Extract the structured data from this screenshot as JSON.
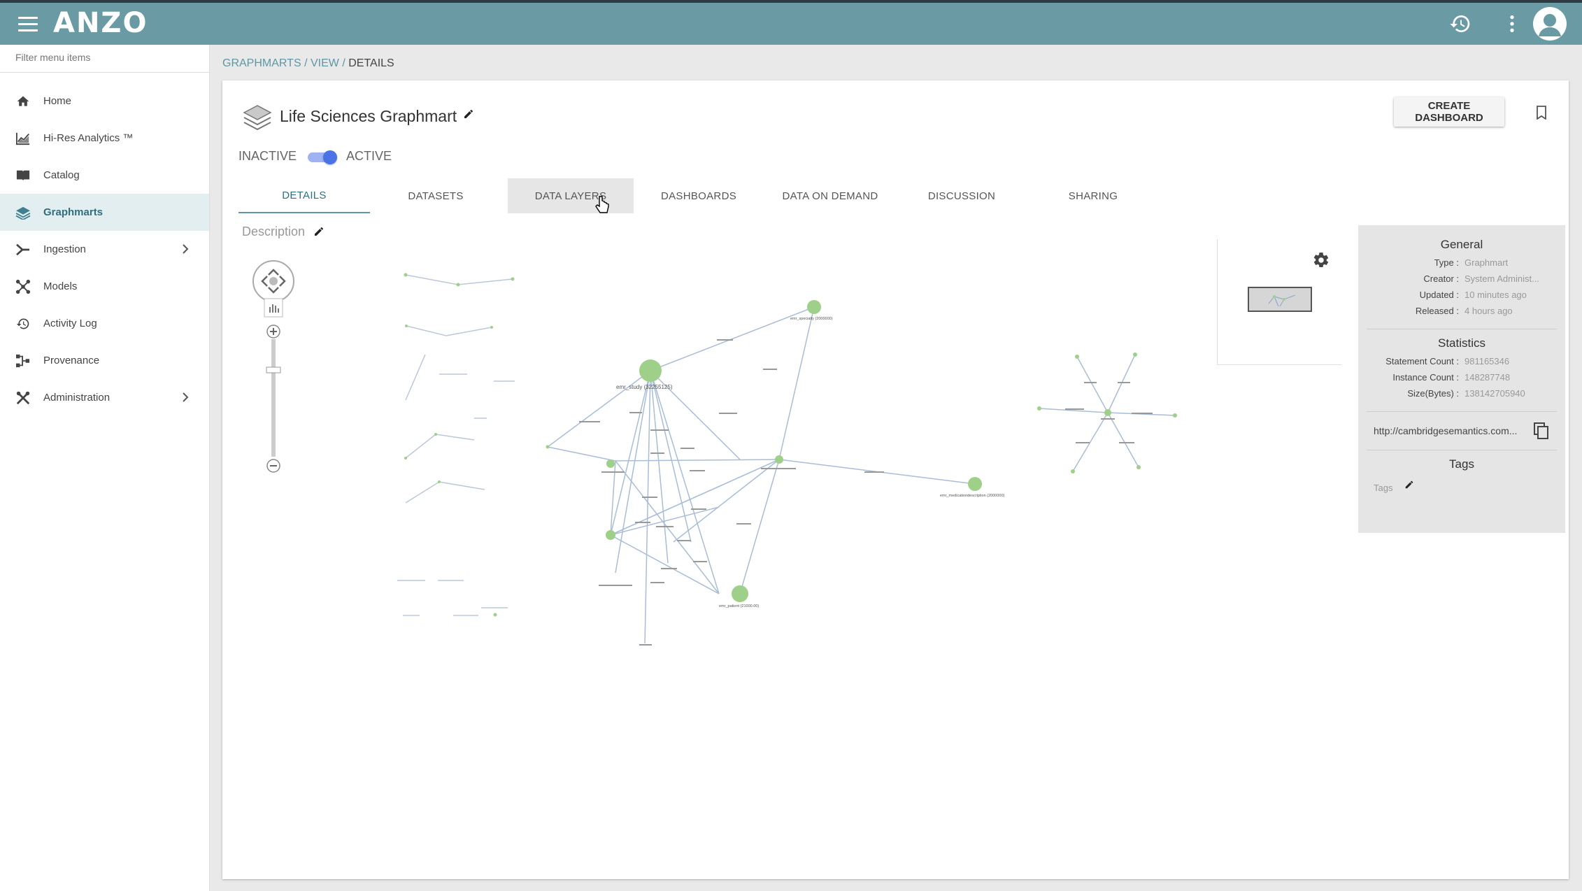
{
  "app": {
    "logo": "ANZO"
  },
  "sidebar": {
    "filter_placeholder": "Filter menu items",
    "items": [
      {
        "label": "Home",
        "icon": "home-icon"
      },
      {
        "label": "Hi-Res Analytics ™",
        "icon": "chart-icon"
      },
      {
        "label": "Catalog",
        "icon": "book-icon"
      },
      {
        "label": "Graphmarts",
        "icon": "layers-icon"
      },
      {
        "label": "Ingestion",
        "icon": "ingestion-icon"
      },
      {
        "label": "Models",
        "icon": "models-icon"
      },
      {
        "label": "Activity Log",
        "icon": "history-icon"
      },
      {
        "label": "Provenance",
        "icon": "provenance-icon"
      },
      {
        "label": "Administration",
        "icon": "tools-icon"
      }
    ]
  },
  "breadcrumb": {
    "part1": "GRAPHMARTS",
    "sep": "/",
    "part2": "VIEW",
    "part3": "DETAILS"
  },
  "header": {
    "title": "Life Sciences Graphmart",
    "create_dashboard": "CREATE DASHBOARD"
  },
  "status": {
    "inactive": "INACTIVE",
    "active": "ACTIVE"
  },
  "tabs": [
    "DETAILS",
    "DATASETS",
    "DATA LAYERS",
    "DASHBOARDS",
    "DATA ON DEMAND",
    "DISCUSSION",
    "SHARING"
  ],
  "description_label": "Description",
  "graph": {
    "node_labels": [
      "emr_study (32255125)",
      "emr_specialty (2000000)",
      "emr_medicationdescription (2000000)",
      "emr_patient (21000.00)"
    ]
  },
  "general": {
    "heading": "General",
    "rows": [
      {
        "k": "Type :",
        "v": "Graphmart"
      },
      {
        "k": "Creator :",
        "v": "System Administ..."
      },
      {
        "k": "Updated :",
        "v": "10 minutes ago"
      },
      {
        "k": "Released :",
        "v": "4 hours ago"
      }
    ]
  },
  "statistics": {
    "heading": "Statistics",
    "rows": [
      {
        "k": "Statement Count :",
        "v": "981165346"
      },
      {
        "k": "Instance Count :",
        "v": "148287748"
      },
      {
        "k": "Size(Bytes) :",
        "v": "138142705940"
      }
    ]
  },
  "uri": "http://cambridgesemantics.com...",
  "tags": {
    "heading": "Tags",
    "placeholder": "Tags"
  },
  "colors": {
    "topbar": "#6a9aa4",
    "accent": "#5e97a4",
    "node": "#9fd08a",
    "edge": "#a9bdd6",
    "toggle": "#4a73e8"
  }
}
